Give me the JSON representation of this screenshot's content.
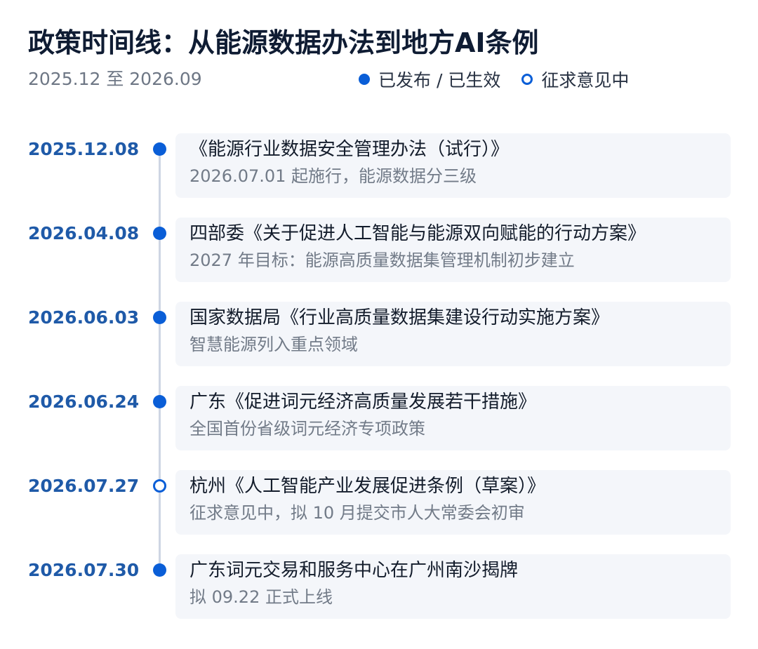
{
  "header": {
    "title": "政策时间线：从能源数据办法到地方AI条例",
    "date_range": "2025.12 至 2026.09"
  },
  "legend": {
    "published_label": "已发布 / 已生效",
    "consultation_label": "征求意见中"
  },
  "colors": {
    "accent": "#0a5ed7",
    "date_text": "#1f5aa8",
    "card_background": "#f4f6fa",
    "axis_line": "#ced6e3"
  },
  "events": [
    {
      "date": "2025.12.08",
      "status": "published",
      "title": "《能源行业数据安全管理办法（试行）》",
      "note": "2026.07.01 起施行，能源数据分三级"
    },
    {
      "date": "2026.04.08",
      "status": "published",
      "title": "四部委《关于促进人工智能与能源双向赋能的行动方案》",
      "note": "2027 年目标：能源高质量数据集管理机制初步建立"
    },
    {
      "date": "2026.06.03",
      "status": "published",
      "title": "国家数据局《行业高质量数据集建设行动实施方案》",
      "note": "智慧能源列入重点领域"
    },
    {
      "date": "2026.06.24",
      "status": "published",
      "title": "广东《促进词元经济高质量发展若干措施》",
      "note": "全国首份省级词元经济专项政策"
    },
    {
      "date": "2026.07.27",
      "status": "consultation",
      "title": "杭州《人工智能产业发展促进条例（草案）》",
      "note": "征求意见中，拟 10 月提交市人大常委会初审"
    },
    {
      "date": "2026.07.30",
      "status": "published",
      "title": "广东词元交易和服务中心在广州南沙揭牌",
      "note": "拟 09.22 正式上线"
    }
  ]
}
